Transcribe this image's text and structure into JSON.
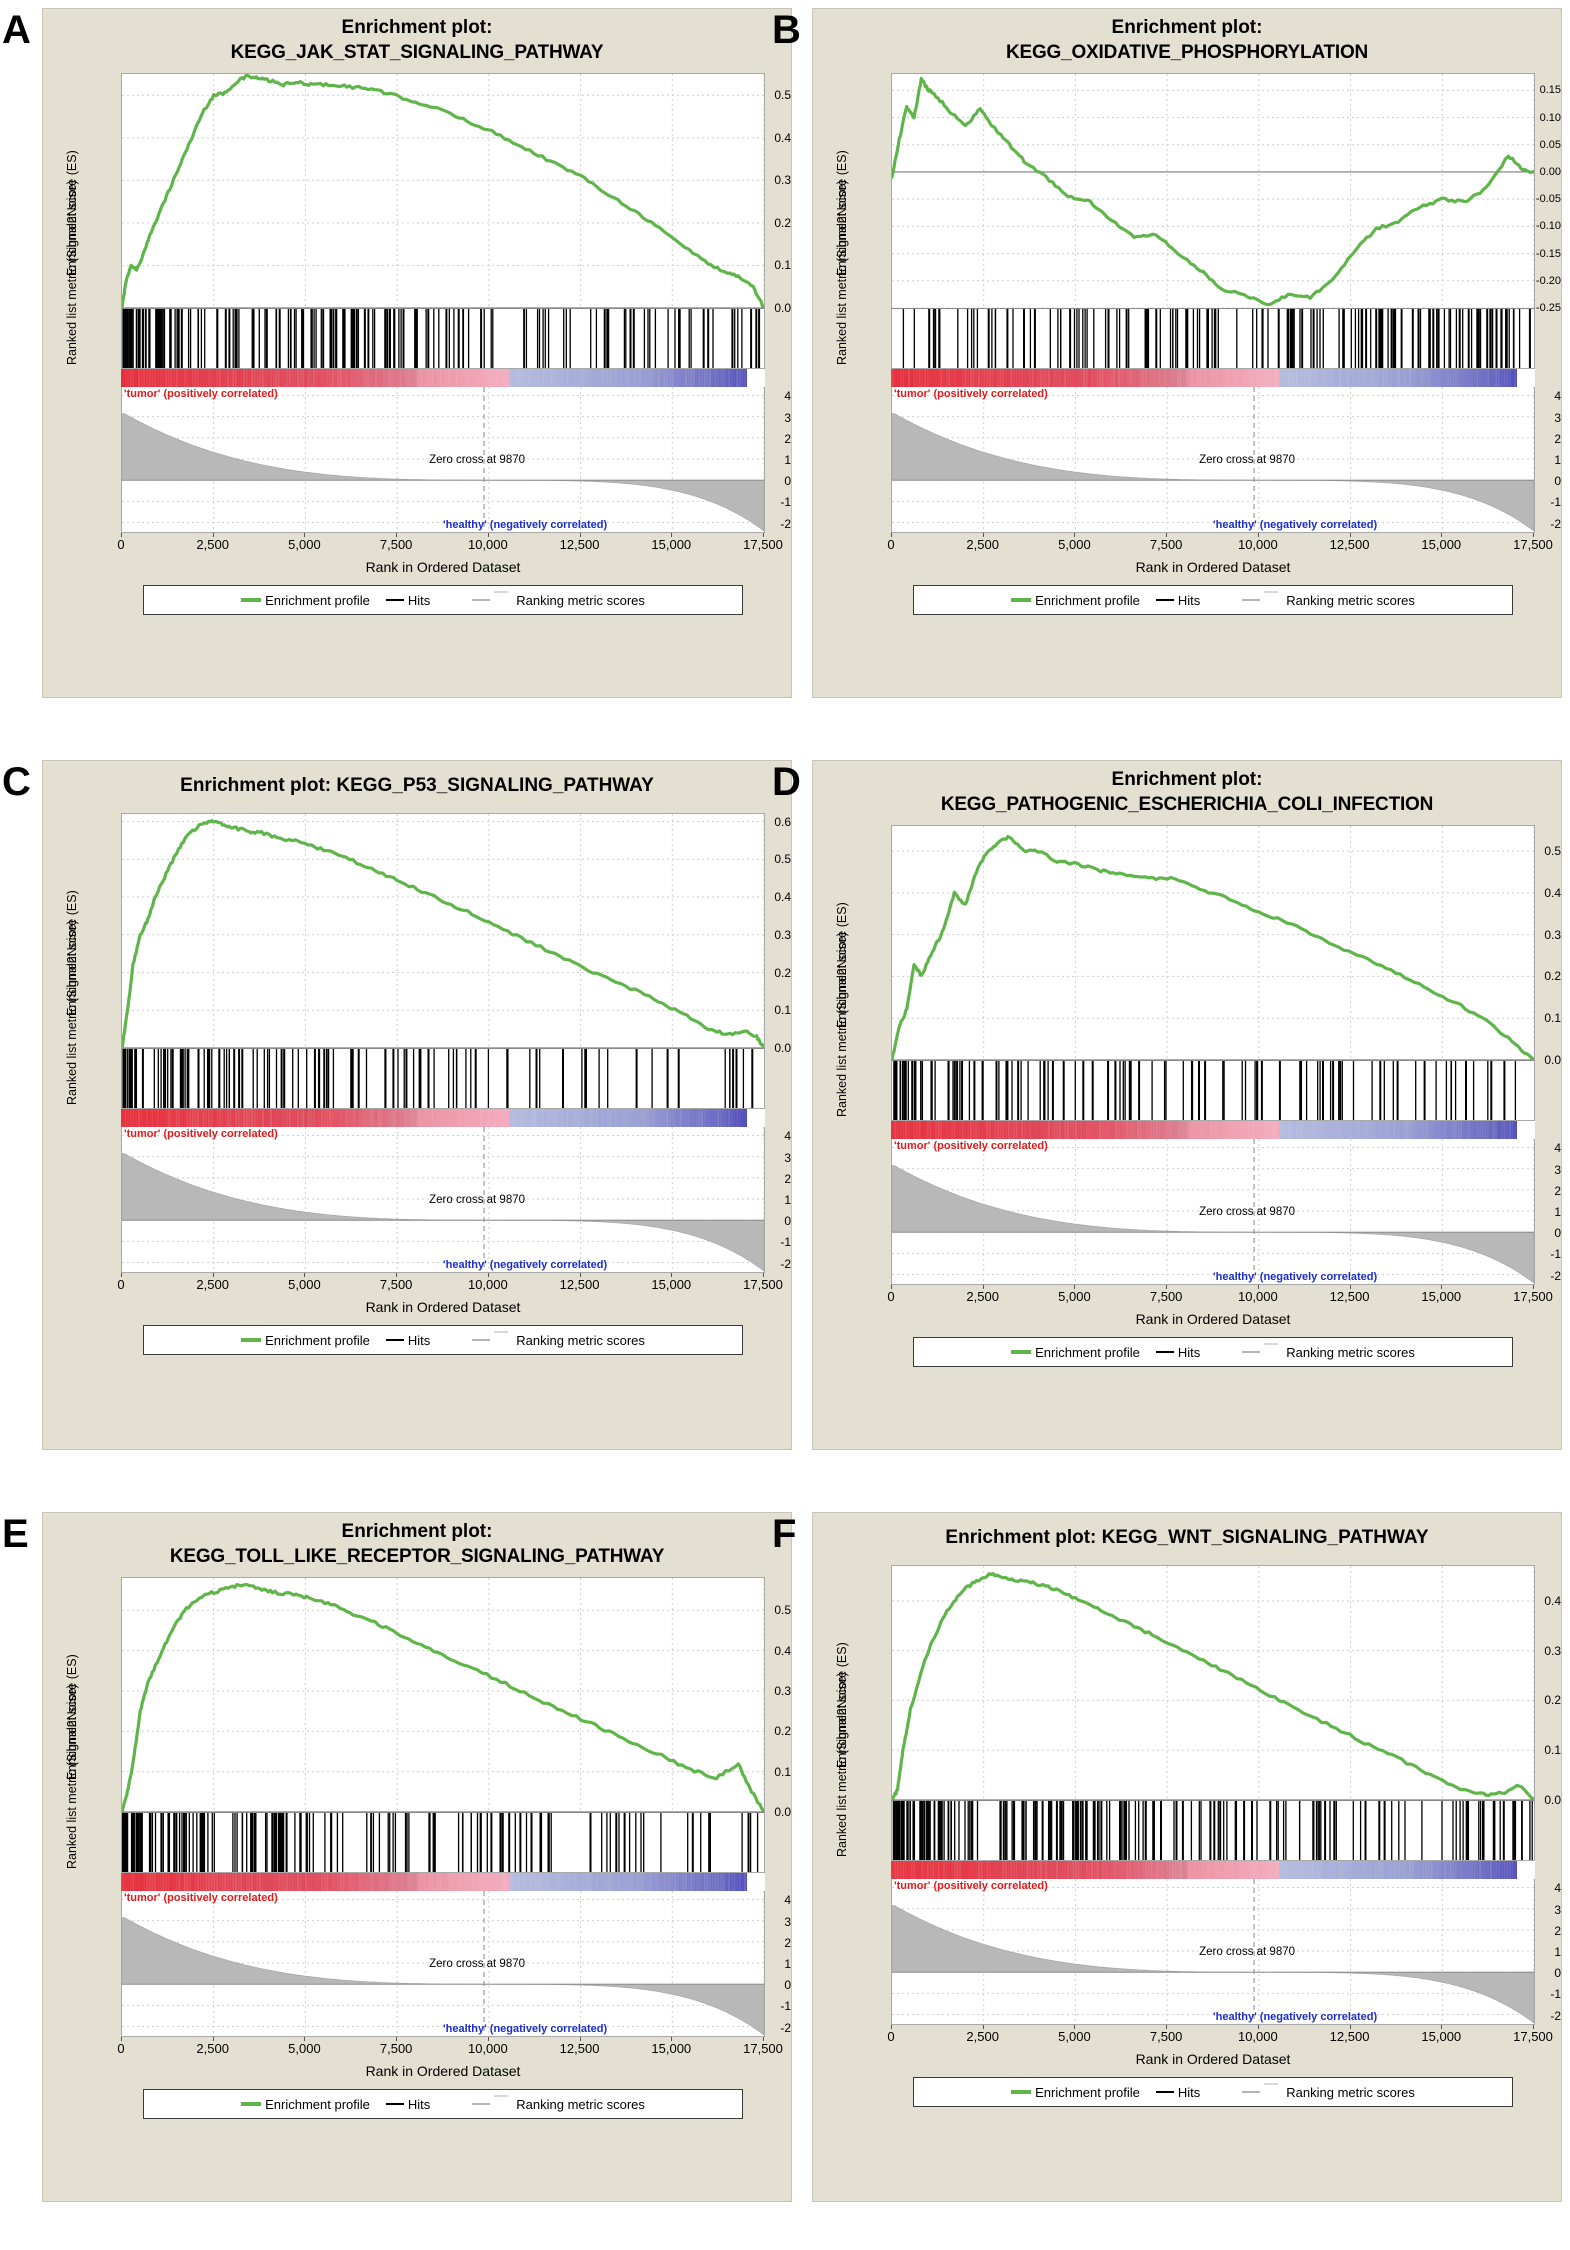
{
  "figure": {
    "background": "#ffffff",
    "panel_background": "#e3e0d1",
    "accent_green": "#5fb54a",
    "pos_corr_color": "#e01b1b",
    "neg_corr_color": "#1b2ec9"
  },
  "common": {
    "title_prefix": "Enrichment plot:",
    "ylabel_es": "Enrichment score (ES)",
    "ylabel_rank": "Ranked list metric (Signal2Noise)",
    "xlabel": "Rank in Ordered Dataset",
    "zero_cross": "Zero cross at 9870",
    "pos_corr": "'tumor' (positively correlated)",
    "neg_corr": "'healthy' (negatively correlated)",
    "legend": {
      "enrichment_profile": "Enrichment profile",
      "hits": "Hits",
      "ranking_metric": "Ranking metric scores"
    },
    "xticks": [
      "0",
      "2,500",
      "5,000",
      "7,500",
      "10,000",
      "12,500",
      "15,000",
      "17,500"
    ],
    "rank_yticks": [
      "4",
      "3",
      "2",
      "1",
      "0",
      "-1",
      "-2"
    ]
  },
  "panels": [
    {
      "letter": "A",
      "title_line1": "Enrichment plot:",
      "title_line2": "KEGG_JAK_STAT_SIGNALING_PATHWAY",
      "two_line": true,
      "es_yticks": [
        "0.5",
        "0.4",
        "0.3",
        "0.2",
        "0.1",
        "0.0"
      ]
    },
    {
      "letter": "B",
      "title_line1": "Enrichment plot:",
      "title_line2": "KEGG_OXIDATIVE_PHOSPHORYLATION",
      "two_line": true,
      "es_yticks": [
        "0.15",
        "0.10",
        "0.05",
        "0.00",
        "-0.05",
        "-0.10",
        "-0.15",
        "-0.20",
        "-0.25"
      ]
    },
    {
      "letter": "C",
      "title_line1": "Enrichment plot: KEGG_P53_SIGNALING_PATHWAY",
      "title_line2": "",
      "two_line": false,
      "es_yticks": [
        "0.6",
        "0.5",
        "0.4",
        "0.3",
        "0.2",
        "0.1",
        "0.0"
      ]
    },
    {
      "letter": "D",
      "title_line1": "Enrichment plot:",
      "title_line2": "KEGG_PATHOGENIC_ESCHERICHIA_COLI_INFECTION",
      "two_line": true,
      "es_yticks": [
        "0.5",
        "0.4",
        "0.3",
        "0.2",
        "0.1",
        "0.0"
      ]
    },
    {
      "letter": "E",
      "title_line1": "Enrichment plot:",
      "title_line2": "KEGG_TOLL_LIKE_RECEPTOR_SIGNALING_PATHWAY",
      "two_line": true,
      "es_yticks": [
        "0.5",
        "0.4",
        "0.3",
        "0.2",
        "0.1",
        "0.0"
      ]
    },
    {
      "letter": "F",
      "title_line1": "Enrichment plot: KEGG_WNT_SIGNALING_PATHWAY",
      "title_line2": "",
      "two_line": false,
      "es_yticks": [
        "0.4",
        "0.3",
        "0.2",
        "0.1",
        "0.0"
      ]
    }
  ],
  "chart_data": [
    {
      "type": "line",
      "panel": "A",
      "title": "Enrichment plot: KEGG_JAK_STAT_SIGNALING_PATHWAY",
      "xlabel": "Rank in Ordered Dataset",
      "ylabel": "Enrichment score (ES)",
      "xlim": [
        0,
        17500
      ],
      "ylim": [
        0.0,
        0.55
      ],
      "grid": true,
      "zero_cross_rank": 9870,
      "series": [
        {
          "name": "Enrichment profile",
          "color": "#5fb54a",
          "x": [
            0,
            100,
            250,
            400,
            600,
            800,
            1000,
            1300,
            1600,
            1900,
            2200,
            2500,
            2800,
            3100,
            3400,
            3700,
            4000,
            4400,
            4800,
            5200,
            5700,
            6200,
            6800,
            7400,
            8000,
            8700,
            9400,
            10200,
            11000,
            11800,
            12600,
            13400,
            14200,
            15000,
            15800,
            16400,
            16800,
            17200,
            17500
          ],
          "y": [
            0.0,
            0.06,
            0.1,
            0.09,
            0.13,
            0.18,
            0.22,
            0.28,
            0.34,
            0.4,
            0.46,
            0.5,
            0.505,
            0.53,
            0.545,
            0.54,
            0.535,
            0.525,
            0.53,
            0.525,
            0.525,
            0.52,
            0.515,
            0.5,
            0.485,
            0.465,
            0.44,
            0.41,
            0.375,
            0.34,
            0.305,
            0.26,
            0.215,
            0.165,
            0.115,
            0.085,
            0.075,
            0.05,
            0.0
          ]
        }
      ]
    },
    {
      "type": "line",
      "panel": "B",
      "title": "Enrichment plot: KEGG_OXIDATIVE_PHOSPHORYLATION",
      "xlabel": "Rank in Ordered Dataset",
      "ylabel": "Enrichment score (ES)",
      "xlim": [
        0,
        17500
      ],
      "ylim": [
        -0.25,
        0.18
      ],
      "grid": true,
      "zero_cross_rank": 9870,
      "series": [
        {
          "name": "Enrichment profile",
          "color": "#5fb54a",
          "x": [
            0,
            200,
            400,
            600,
            800,
            1000,
            1200,
            1600,
            2000,
            2400,
            2800,
            3200,
            3600,
            4200,
            4800,
            5400,
            6000,
            6600,
            7200,
            7800,
            8400,
            9000,
            9600,
            10200,
            10800,
            11400,
            12000,
            12600,
            13200,
            13800,
            14400,
            15000,
            15600,
            16200,
            16800,
            17200,
            17500
          ],
          "y": [
            -0.01,
            0.06,
            0.12,
            0.1,
            0.17,
            0.15,
            0.14,
            0.11,
            0.085,
            0.115,
            0.08,
            0.05,
            0.02,
            -0.01,
            -0.045,
            -0.055,
            -0.09,
            -0.12,
            -0.115,
            -0.15,
            -0.18,
            -0.215,
            -0.225,
            -0.245,
            -0.225,
            -0.23,
            -0.2,
            -0.145,
            -0.105,
            -0.09,
            -0.065,
            -0.05,
            -0.055,
            -0.03,
            0.03,
            0.005,
            0.0
          ]
        }
      ]
    },
    {
      "type": "line",
      "panel": "C",
      "title": "Enrichment plot: KEGG_P53_SIGNALING_PATHWAY",
      "xlabel": "Rank in Ordered Dataset",
      "ylabel": "Enrichment score (ES)",
      "xlim": [
        0,
        17500
      ],
      "ylim": [
        0.0,
        0.62
      ],
      "grid": true,
      "zero_cross_rank": 9870,
      "series": [
        {
          "name": "Enrichment profile",
          "color": "#5fb54a",
          "x": [
            0,
            150,
            300,
            500,
            700,
            900,
            1200,
            1500,
            1800,
            2100,
            2400,
            2700,
            3000,
            3400,
            3800,
            4300,
            4900,
            5500,
            6200,
            6900,
            7600,
            8400,
            9200,
            10000,
            10900,
            11800,
            12700,
            13600,
            14500,
            15300,
            16000,
            16500,
            17000,
            17300,
            17500
          ],
          "y": [
            0.0,
            0.1,
            0.22,
            0.3,
            0.34,
            0.4,
            0.46,
            0.52,
            0.565,
            0.59,
            0.6,
            0.595,
            0.585,
            0.575,
            0.57,
            0.555,
            0.545,
            0.525,
            0.5,
            0.47,
            0.44,
            0.405,
            0.37,
            0.335,
            0.29,
            0.25,
            0.205,
            0.17,
            0.13,
            0.09,
            0.05,
            0.035,
            0.045,
            0.03,
            0.0
          ]
        }
      ]
    },
    {
      "type": "line",
      "panel": "D",
      "title": "Enrichment plot: KEGG_PATHOGENIC_ESCHERICHIA_COLI_INFECTION",
      "xlabel": "Rank in Ordered Dataset",
      "ylabel": "Enrichment score (ES)",
      "xlim": [
        0,
        17500
      ],
      "ylim": [
        0.0,
        0.56
      ],
      "grid": true,
      "zero_cross_rank": 9870,
      "series": [
        {
          "name": "Enrichment profile",
          "color": "#5fb54a",
          "x": [
            0,
            200,
            400,
            600,
            800,
            1100,
            1400,
            1700,
            2000,
            2300,
            2600,
            2900,
            3200,
            3600,
            4000,
            4500,
            5000,
            5600,
            6200,
            6900,
            7600,
            8400,
            9200,
            10000,
            10900,
            11800,
            12700,
            13600,
            14500,
            15400,
            16200,
            16900,
            17500
          ],
          "y": [
            0.0,
            0.08,
            0.12,
            0.23,
            0.2,
            0.26,
            0.31,
            0.4,
            0.37,
            0.45,
            0.5,
            0.52,
            0.535,
            0.5,
            0.5,
            0.475,
            0.47,
            0.455,
            0.445,
            0.435,
            0.435,
            0.41,
            0.385,
            0.355,
            0.325,
            0.285,
            0.25,
            0.215,
            0.175,
            0.135,
            0.095,
            0.045,
            0.0
          ]
        }
      ]
    },
    {
      "type": "line",
      "panel": "E",
      "title": "Enrichment plot: KEGG_TOLL_LIKE_RECEPTOR_SIGNALING_PATHWAY",
      "xlabel": "Rank in Ordered Dataset",
      "ylabel": "Enrichment score (ES)",
      "xlim": [
        0,
        17500
      ],
      "ylim": [
        0.0,
        0.58
      ],
      "grid": true,
      "zero_cross_rank": 9870,
      "series": [
        {
          "name": "Enrichment profile",
          "color": "#5fb54a",
          "x": [
            0,
            150,
            300,
            500,
            700,
            1000,
            1300,
            1700,
            2100,
            2500,
            2900,
            3300,
            3700,
            4100,
            4600,
            5100,
            5700,
            6300,
            7000,
            7700,
            8500,
            9300,
            10200,
            11100,
            12000,
            12900,
            13800,
            14700,
            15500,
            16200,
            16800,
            17100,
            17500
          ],
          "y": [
            0.0,
            0.05,
            0.12,
            0.25,
            0.32,
            0.38,
            0.44,
            0.5,
            0.53,
            0.545,
            0.555,
            0.565,
            0.555,
            0.545,
            0.54,
            0.53,
            0.515,
            0.49,
            0.465,
            0.435,
            0.4,
            0.365,
            0.33,
            0.29,
            0.25,
            0.215,
            0.175,
            0.14,
            0.105,
            0.085,
            0.12,
            0.06,
            0.0
          ]
        }
      ]
    },
    {
      "type": "line",
      "panel": "F",
      "title": "Enrichment plot: KEGG_WNT_SIGNALING_PATHWAY",
      "xlabel": "Rank in Ordered Dataset",
      "ylabel": "Enrichment score (ES)",
      "xlim": [
        0,
        17500
      ],
      "ylim": [
        0.0,
        0.47
      ],
      "grid": true,
      "zero_cross_rank": 9870,
      "series": [
        {
          "name": "Enrichment profile",
          "color": "#5fb54a",
          "x": [
            0,
            150,
            300,
            500,
            800,
            1100,
            1500,
            1900,
            2300,
            2700,
            3100,
            3500,
            3900,
            4400,
            5000,
            5600,
            6300,
            7000,
            7800,
            8600,
            9400,
            10300,
            11200,
            12100,
            13000,
            13900,
            14800,
            15600,
            16200,
            16700,
            17100,
            17500
          ],
          "y": [
            0.0,
            0.02,
            0.1,
            0.18,
            0.26,
            0.32,
            0.38,
            0.42,
            0.44,
            0.455,
            0.445,
            0.44,
            0.435,
            0.425,
            0.405,
            0.385,
            0.36,
            0.335,
            0.305,
            0.275,
            0.245,
            0.21,
            0.175,
            0.145,
            0.11,
            0.08,
            0.045,
            0.02,
            0.01,
            0.015,
            0.03,
            0.0
          ]
        }
      ]
    }
  ]
}
